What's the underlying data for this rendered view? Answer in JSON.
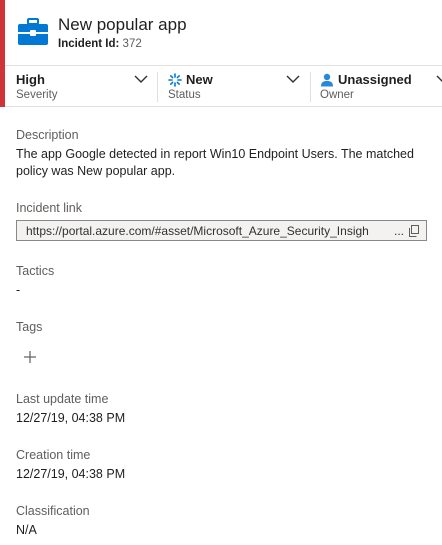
{
  "incident": {
    "title": "New popular app",
    "id_label": "Incident Id:",
    "id_value": "372"
  },
  "dropdowns": {
    "severity": {
      "value": "High",
      "label": "Severity"
    },
    "status": {
      "value": "New",
      "label": "Status"
    },
    "owner": {
      "value": "Unassigned",
      "label": "Owner"
    }
  },
  "fields": {
    "description": {
      "label": "Description",
      "value": "The app Google detected in report Win10 Endpoint Users. The matched policy was New popular app."
    },
    "incident_link": {
      "label": "Incident link",
      "value": "https://portal.azure.com/#asset/Microsoft_Azure_Security_Insigh"
    },
    "tactics": {
      "label": "Tactics",
      "value": "-"
    },
    "tags": {
      "label": "Tags"
    },
    "last_update": {
      "label": "Last update time",
      "value": "12/27/19, 04:38 PM"
    },
    "creation": {
      "label": "Creation time",
      "value": "12/27/19, 04:38 PM"
    },
    "classification": {
      "label": "Classification",
      "value": "N/A"
    }
  },
  "colors": {
    "severity_accent": "#d13438",
    "app_icon": "#0078d4",
    "status_icon": "#0078d4",
    "owner_icon": "#2b88d8"
  },
  "icons": [
    "briefcase-icon",
    "chevron-down-icon",
    "spinner-icon",
    "person-icon",
    "copy-icon",
    "plus-icon"
  ]
}
